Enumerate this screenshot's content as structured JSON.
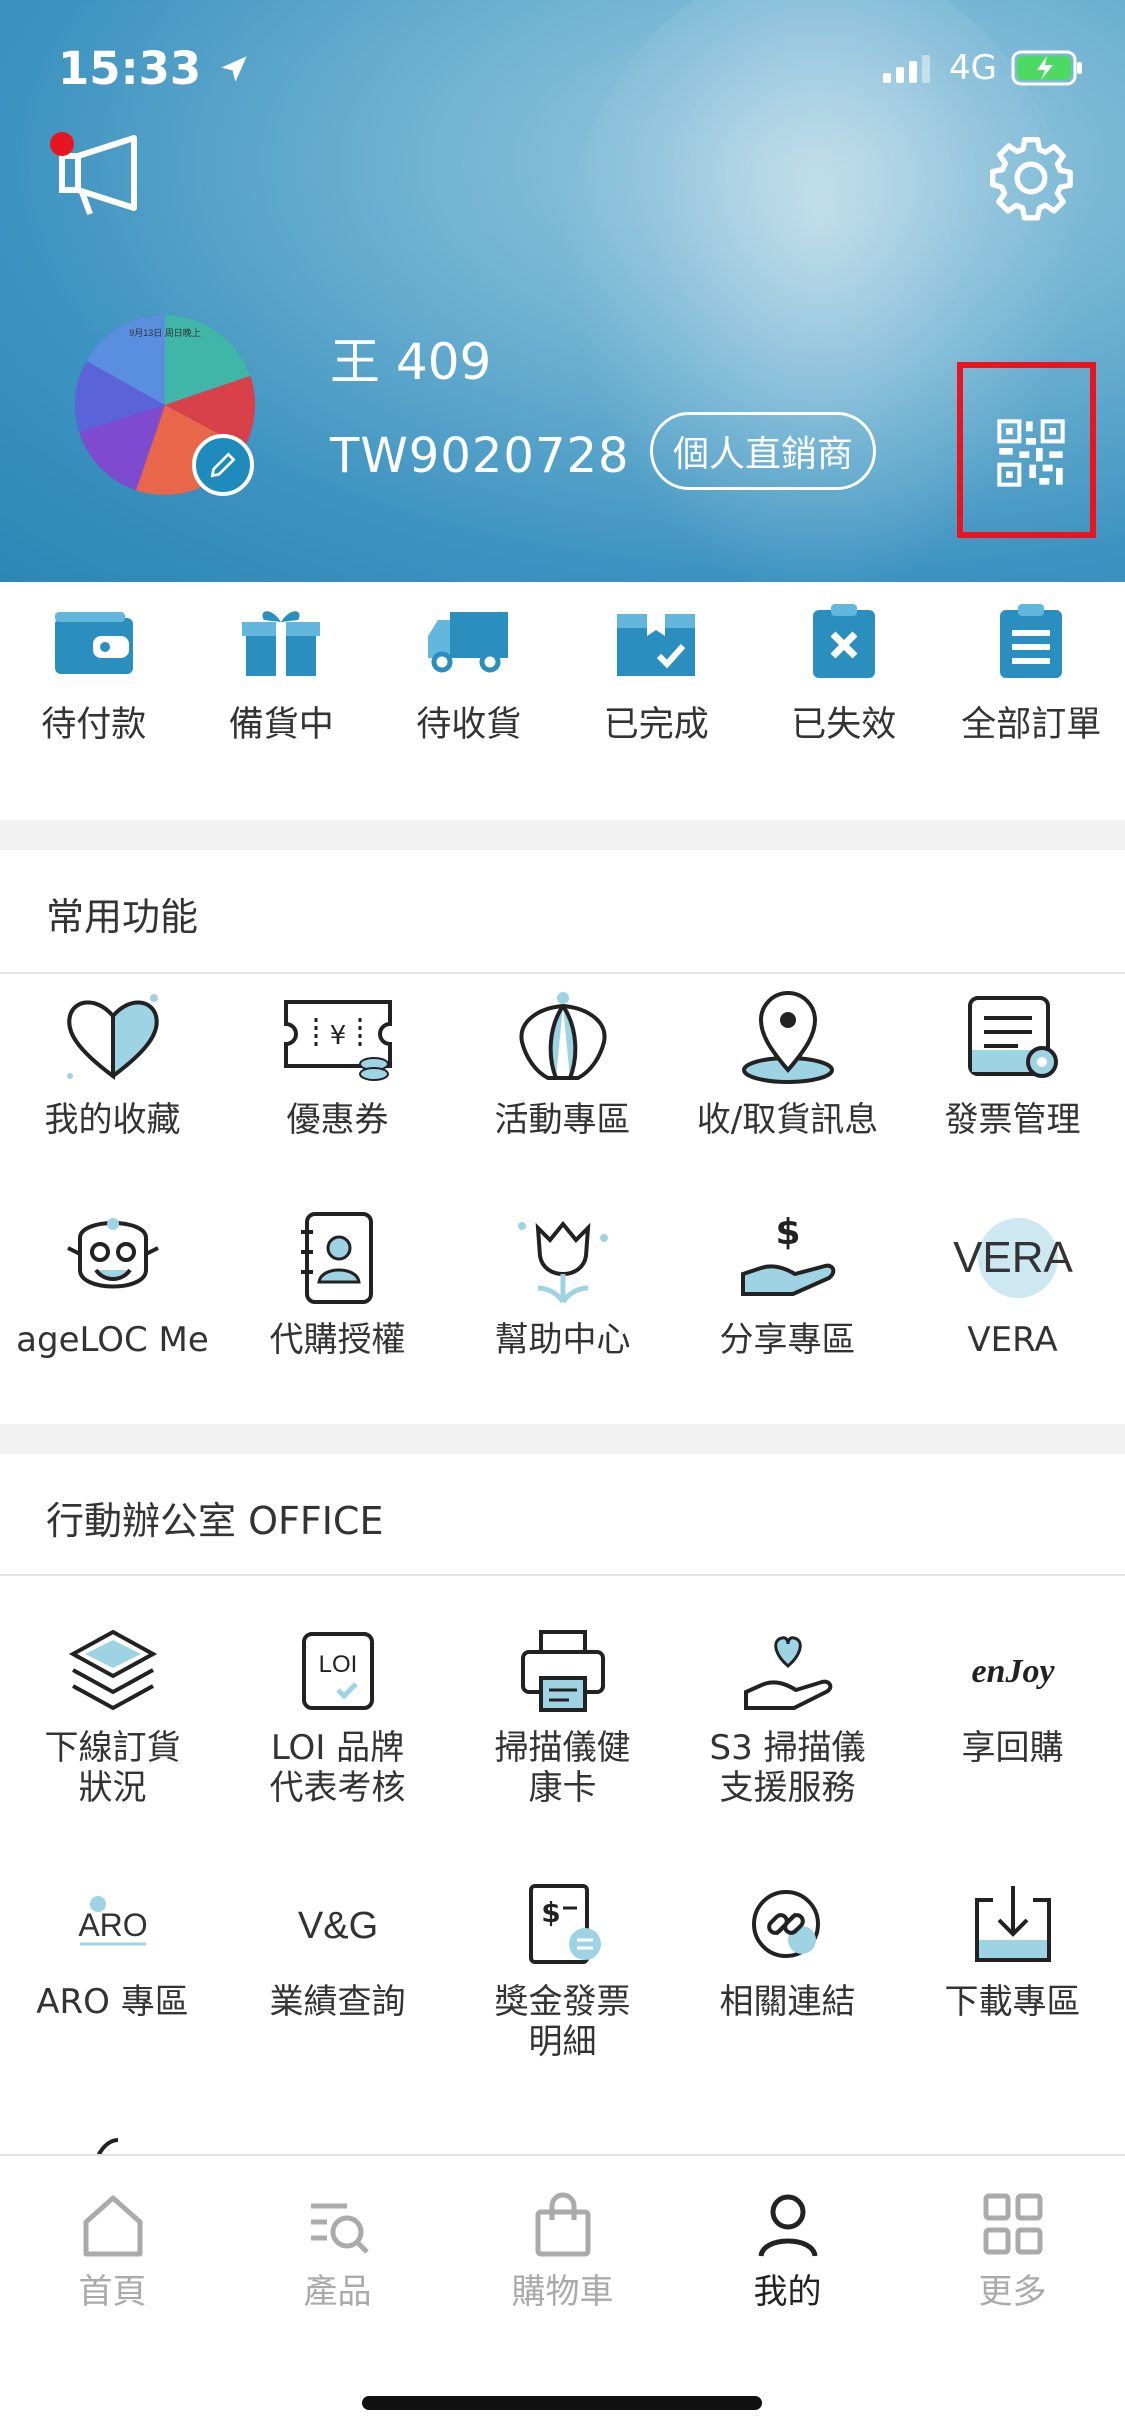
{
  "status_bar": {
    "time": "15:33",
    "network": "4G"
  },
  "profile": {
    "name": "王 409",
    "member_id": "TW9020728",
    "member_type": "個人直銷商",
    "avatar_caption": "9月13日 周日晚上"
  },
  "orders": [
    {
      "label": "待付款",
      "icon": "wallet-icon"
    },
    {
      "label": "備貨中",
      "icon": "gift-box-icon"
    },
    {
      "label": "待收貨",
      "icon": "truck-icon"
    },
    {
      "label": "已完成",
      "icon": "completed-box-icon"
    },
    {
      "label": "已失效",
      "icon": "invalid-clipboard-icon"
    },
    {
      "label": "全部訂單",
      "icon": "all-orders-icon"
    }
  ],
  "common": {
    "title": "常用功能",
    "items": [
      {
        "label": "我的收藏"
      },
      {
        "label": "優惠券"
      },
      {
        "label": "活動專區"
      },
      {
        "label": "收/取貨訊息"
      },
      {
        "label": "發票管理"
      },
      {
        "label": "ageLOC Me"
      },
      {
        "label": "代購授權"
      },
      {
        "label": "幫助中心"
      },
      {
        "label": "分享專區"
      },
      {
        "label": "VERA"
      }
    ],
    "vera_logo": "VERA"
  },
  "office": {
    "title": "行動辦公室 OFFICE",
    "items": [
      {
        "label": "下線訂貨\n狀況"
      },
      {
        "label": "LOI 品牌\n代表考核"
      },
      {
        "label": "掃描儀健\n康卡"
      },
      {
        "label": "S3 掃描儀\n支援服務"
      },
      {
        "label": "享回購"
      },
      {
        "label": "ARO 專區"
      },
      {
        "label": "業績查詢"
      },
      {
        "label": "獎金發票\n明細"
      },
      {
        "label": "相關連結"
      },
      {
        "label": "下載專區"
      }
    ],
    "logos": {
      "loi": "LOI",
      "enjoy": "enJoy",
      "aro": "ARO",
      "vg": "V&G"
    }
  },
  "tabbar": [
    {
      "label": "首頁",
      "active": false
    },
    {
      "label": "產品",
      "active": false
    },
    {
      "label": "購物車",
      "active": false
    },
    {
      "label": "我的",
      "active": true
    },
    {
      "label": "更多",
      "active": false
    }
  ],
  "colors": {
    "accent": "#2a8fbf",
    "highlight": "#e8141f",
    "icon_fill": "#9ed3e4"
  }
}
